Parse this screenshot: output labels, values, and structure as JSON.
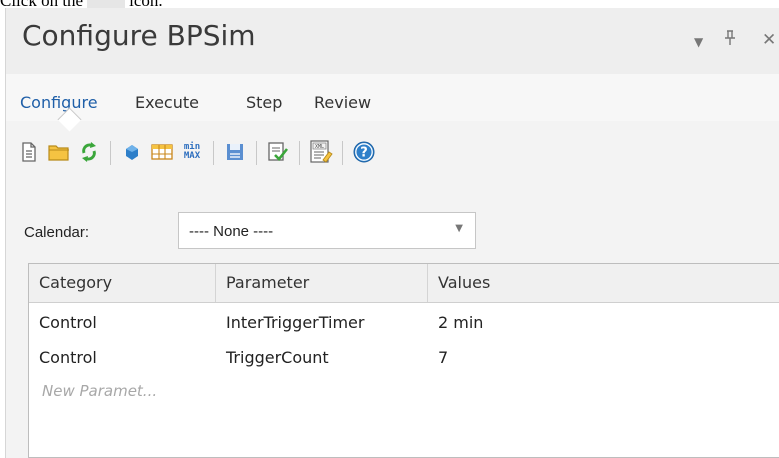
{
  "instruction": {
    "before": "Click on the",
    "after": "icon."
  },
  "window": {
    "title": "Configure BPSim"
  },
  "tabs": [
    {
      "label": "Configure"
    },
    {
      "label": "Execute"
    },
    {
      "label": "Step"
    },
    {
      "label": "Review"
    }
  ],
  "toolbar_icons": [
    "new-document-icon",
    "open-folder-icon",
    "refresh-icon",
    "shape-icon",
    "table-icon",
    "min-max-icon",
    "save-icon",
    "validate-icon",
    "xml-export-icon",
    "help-icon"
  ],
  "toolbar_text": {
    "min": "min",
    "max": "MAX",
    "xml": "XML"
  },
  "calendar": {
    "label": "Calendar:",
    "value": "---- None ----"
  },
  "grid": {
    "headers": [
      "Category",
      "Parameter",
      "Values"
    ],
    "rows": [
      {
        "category": "Control",
        "parameter": "InterTriggerTimer",
        "value": "2 min"
      },
      {
        "category": "Control",
        "parameter": "TriggerCount",
        "value": "7"
      }
    ],
    "new_row_placeholder": "New Paramet..."
  },
  "colors": {
    "accent": "#1f5fa8",
    "help": "#2e7fc9",
    "refresh": "#3aa63a"
  }
}
